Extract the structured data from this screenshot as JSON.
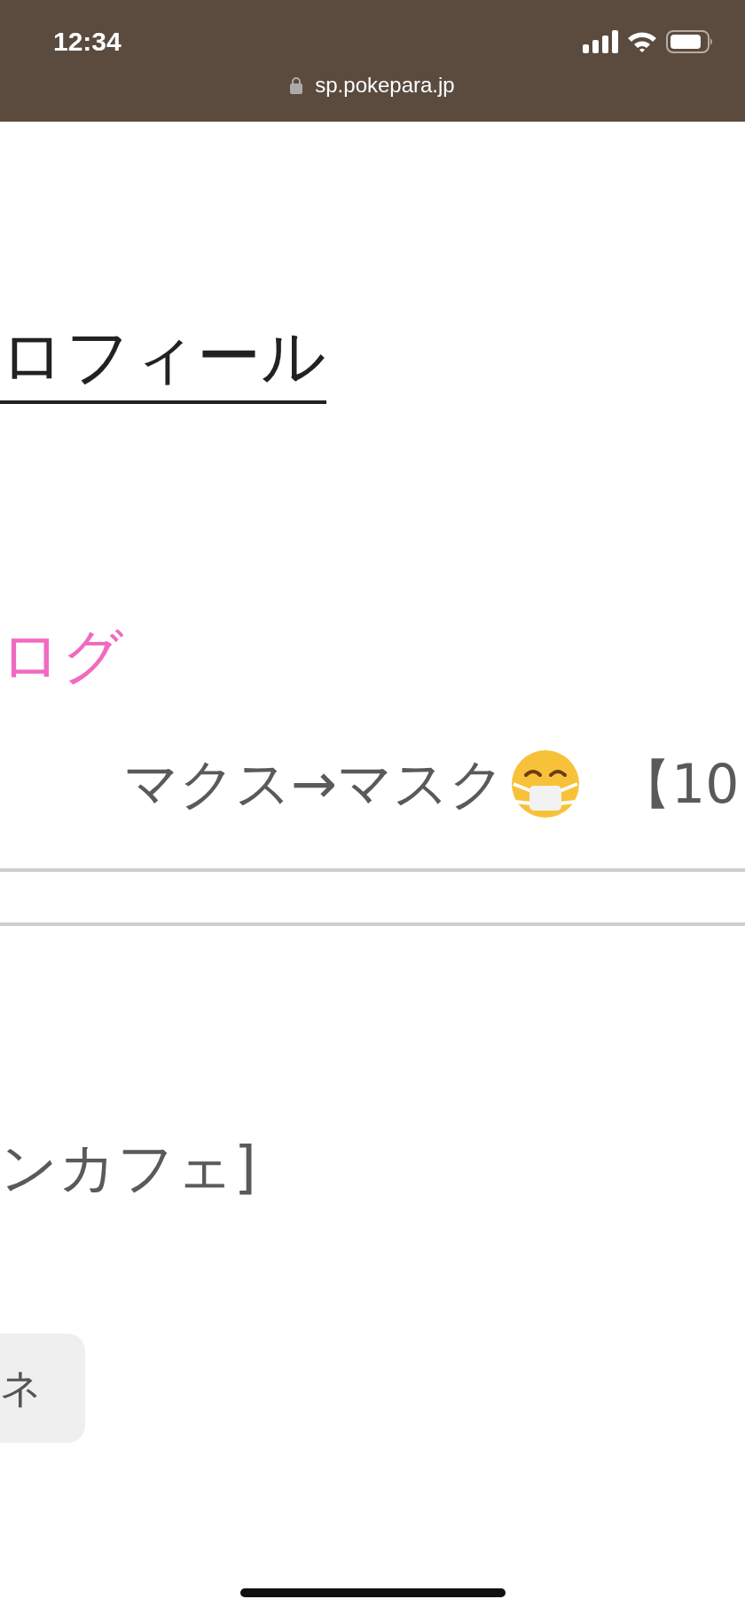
{
  "status_bar": {
    "time": "12:34",
    "url": "sp.pokepara.jp"
  },
  "profile_link": "ロフィール",
  "blog_heading": "ログ",
  "blog_entry": {
    "title": "マクス→マスク",
    "tail": "【10"
  },
  "shop_text": "ンカフェ]",
  "button": "ネ"
}
